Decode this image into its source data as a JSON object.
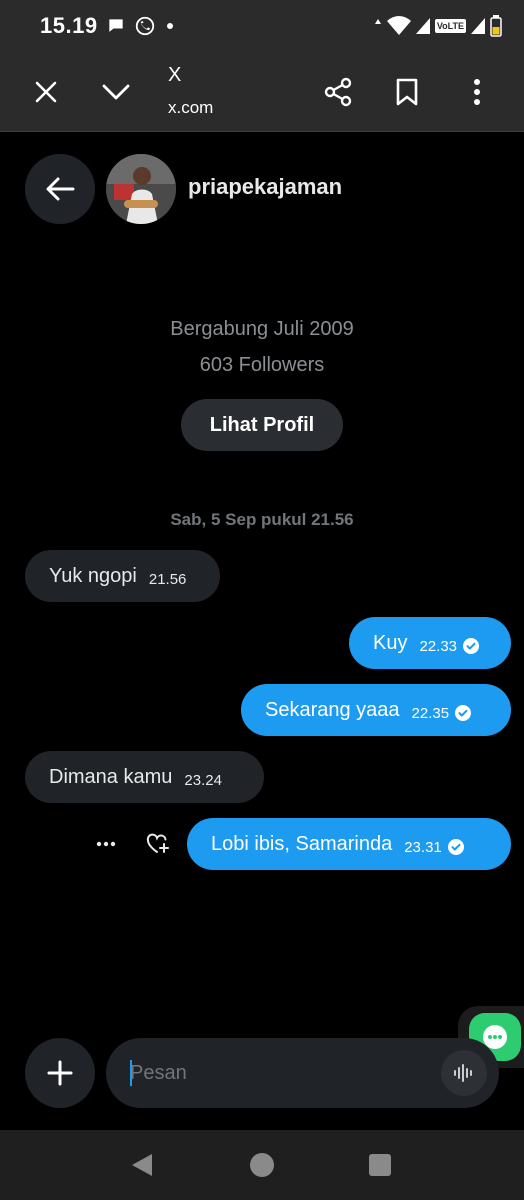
{
  "status_bar": {
    "time": "15.19",
    "volte": "VoLTE"
  },
  "browser": {
    "title": "X",
    "url": "x.com"
  },
  "chat": {
    "username": "priapekajaman",
    "joined": "Bergabung Juli 2009",
    "followers": "603 Followers",
    "profile_button": "Lihat Profil",
    "date_separator": "Sab, 5 Sep pukul 21.56"
  },
  "messages": [
    {
      "direction": "in",
      "text": "Yuk ngopi",
      "time": "21.56"
    },
    {
      "direction": "out",
      "text": "Kuy",
      "time": "22.33"
    },
    {
      "direction": "out",
      "text": "Sekarang yaaa",
      "time": "22.35"
    },
    {
      "direction": "in",
      "text": "Dimana kamu",
      "time": "23.24"
    },
    {
      "direction": "out",
      "text": "Lobi ibis, Samarinda",
      "time": "23.31"
    }
  ],
  "composer": {
    "placeholder": "Pesan"
  },
  "colors": {
    "accent": "#1d9bf0",
    "incoming_bubble": "#202327",
    "fab": "#2ecc71"
  }
}
